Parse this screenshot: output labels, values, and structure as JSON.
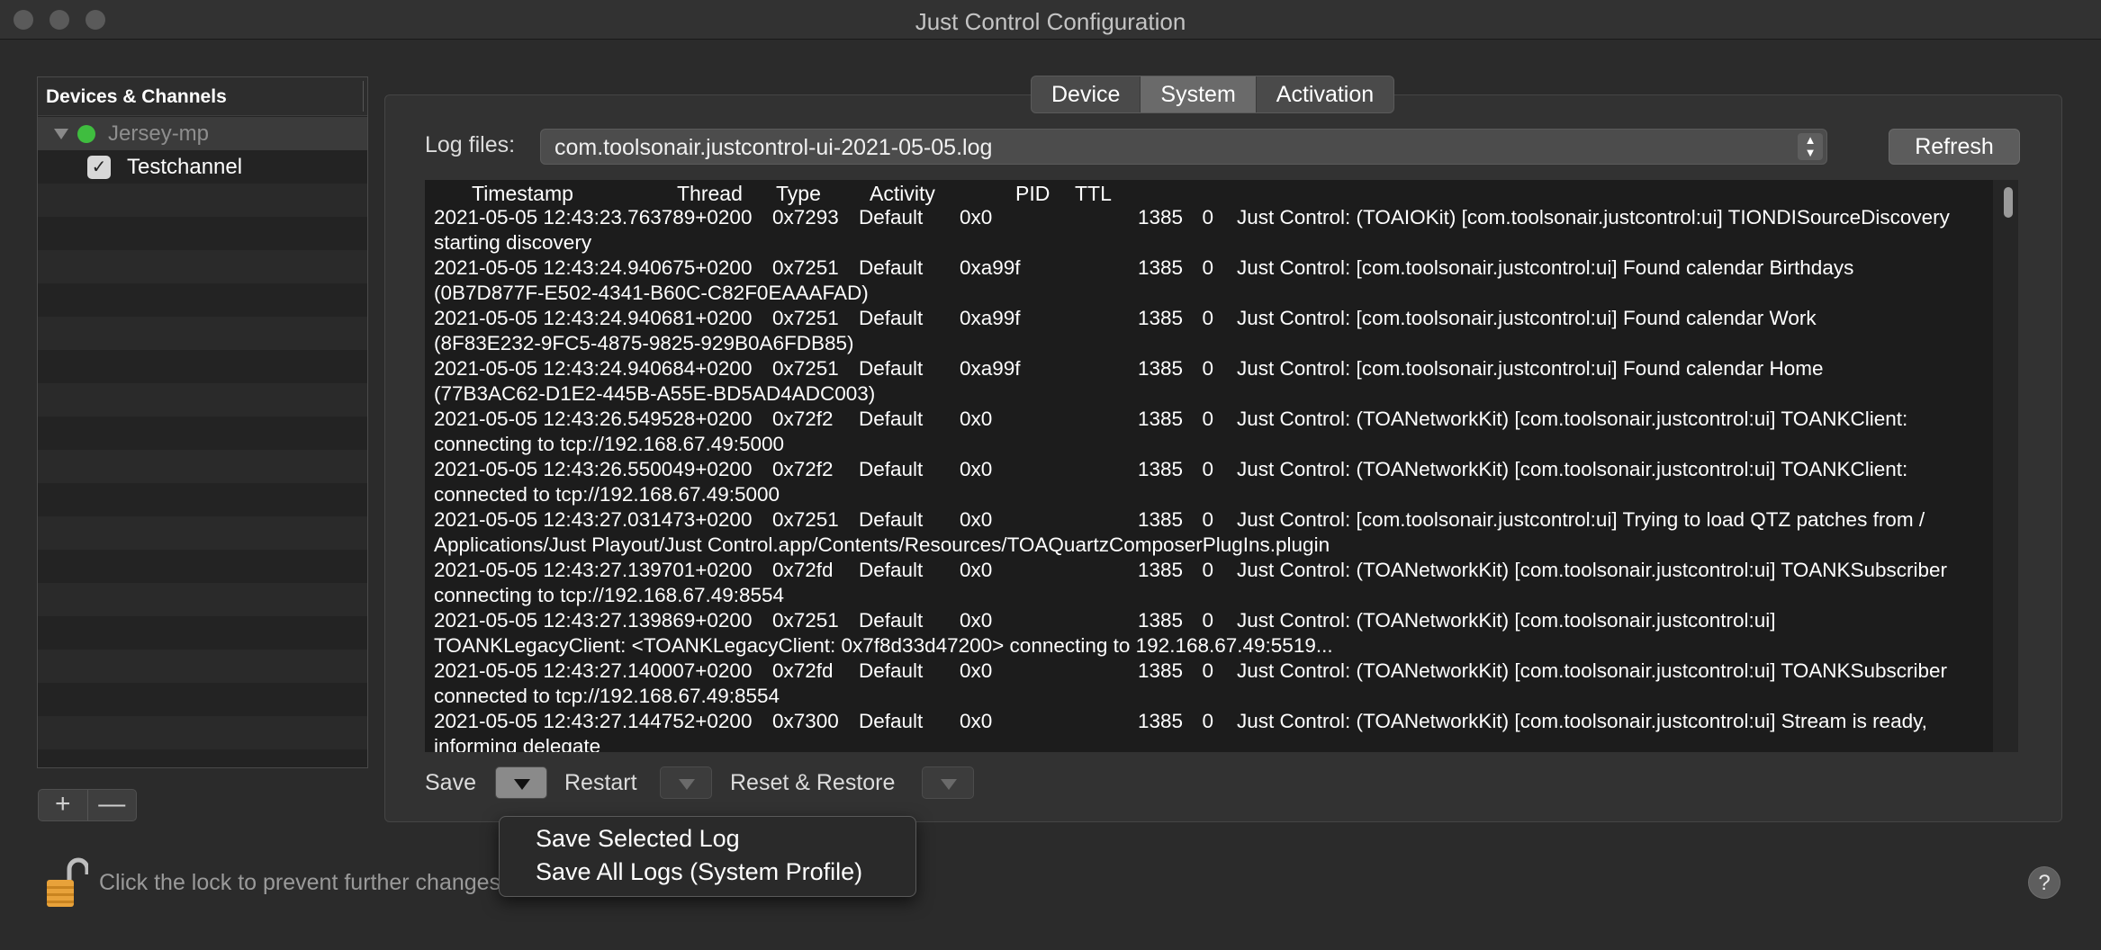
{
  "window": {
    "title": "Just Control Configuration"
  },
  "sidebar": {
    "header": "Devices & Channels",
    "device": {
      "label": "Jersey-mp",
      "status_color": "#3fbd3f"
    },
    "channel": {
      "label": "Testchannel",
      "checked": true
    },
    "buttons": {
      "add": "+",
      "remove": "—"
    }
  },
  "tabs": [
    {
      "label": "Device",
      "active": false
    },
    {
      "label": "System",
      "active": true
    },
    {
      "label": "Activation",
      "active": false
    }
  ],
  "logfiles": {
    "label": "Log files:",
    "selected": "com.toolsonair.justcontrol-ui-2021-05-05.log",
    "refresh": "Refresh"
  },
  "log": {
    "columns": [
      "Timestamp",
      "Thread",
      "Type",
      "Activity",
      "PID",
      "TTL"
    ],
    "entries": [
      {
        "ts": "2021-05-05 12:43:23.763789+0200",
        "thread": "0x7293",
        "type": "Default",
        "activity": "0x0",
        "pid": "1385",
        "ttl": "0",
        "msg": "Just Control: (TOAIOKit) [com.toolsonair.justcontrol:ui] TIONDISourceDiscovery",
        "cont": "starting discovery"
      },
      {
        "ts": "2021-05-05 12:43:24.940675+0200",
        "thread": "0x7251",
        "type": "Default",
        "activity": "0xa99f",
        "pid": "1385",
        "ttl": "0",
        "msg": "Just Control: [com.toolsonair.justcontrol:ui] Found calendar Birthdays",
        "cont": "(0B7D877F-E502-4341-B60C-C82F0EAAAFAD)"
      },
      {
        "ts": "2021-05-05 12:43:24.940681+0200",
        "thread": "0x7251",
        "type": "Default",
        "activity": "0xa99f",
        "pid": "1385",
        "ttl": "0",
        "msg": "Just Control: [com.toolsonair.justcontrol:ui] Found calendar Work",
        "cont": "(8F83E232-9FC5-4875-9825-929B0A6FDB85)"
      },
      {
        "ts": "2021-05-05 12:43:24.940684+0200",
        "thread": "0x7251",
        "type": "Default",
        "activity": "0xa99f",
        "pid": "1385",
        "ttl": "0",
        "msg": "Just Control: [com.toolsonair.justcontrol:ui] Found calendar Home",
        "cont": "(77B3AC62-D1E2-445B-A55E-BD5AD4ADC003)"
      },
      {
        "ts": "2021-05-05 12:43:26.549528+0200",
        "thread": "0x72f2",
        "type": "Default",
        "activity": "0x0",
        "pid": "1385",
        "ttl": "0",
        "msg": "Just Control: (TOANetworkKit) [com.toolsonair.justcontrol:ui] TOANKClient:",
        "cont": "connecting to tcp://192.168.67.49:5000"
      },
      {
        "ts": "2021-05-05 12:43:26.550049+0200",
        "thread": "0x72f2",
        "type": "Default",
        "activity": "0x0",
        "pid": "1385",
        "ttl": "0",
        "msg": "Just Control: (TOANetworkKit) [com.toolsonair.justcontrol:ui] TOANKClient:",
        "cont": "connected to tcp://192.168.67.49:5000"
      },
      {
        "ts": "2021-05-05 12:43:27.031473+0200",
        "thread": "0x7251",
        "type": "Default",
        "activity": "0x0",
        "pid": "1385",
        "ttl": "0",
        "msg": "Just Control: [com.toolsonair.justcontrol:ui] Trying to load QTZ patches from /",
        "cont": "Applications/Just Playout/Just Control.app/Contents/Resources/TOAQuartzComposerPlugIns.plugin"
      },
      {
        "ts": "2021-05-05 12:43:27.139701+0200",
        "thread": "0x72fd",
        "type": "Default",
        "activity": "0x0",
        "pid": "1385",
        "ttl": "0",
        "msg": "Just Control: (TOANetworkKit) [com.toolsonair.justcontrol:ui] TOANKSubscriber",
        "cont": "connecting to tcp://192.168.67.49:8554"
      },
      {
        "ts": "2021-05-05 12:43:27.139869+0200",
        "thread": "0x7251",
        "type": "Default",
        "activity": "0x0",
        "pid": "1385",
        "ttl": "0",
        "msg": "Just Control: (TOANetworkKit) [com.toolsonair.justcontrol:ui]",
        "cont": "TOANKLegacyClient: <TOANKLegacyClient: 0x7f8d33d47200> connecting to 192.168.67.49:5519..."
      },
      {
        "ts": "2021-05-05 12:43:27.140007+0200",
        "thread": "0x72fd",
        "type": "Default",
        "activity": "0x0",
        "pid": "1385",
        "ttl": "0",
        "msg": "Just Control: (TOANetworkKit) [com.toolsonair.justcontrol:ui] TOANKSubscriber",
        "cont": "connected to tcp://192.168.67.49:8554"
      },
      {
        "ts": "2021-05-05 12:43:27.144752+0200",
        "thread": "0x7300",
        "type": "Default",
        "activity": "0x0",
        "pid": "1385",
        "ttl": "0",
        "msg": "Just Control: (TOANetworkKit) [com.toolsonair.justcontrol:ui] Stream is ready,",
        "cont": "informing delegate"
      }
    ]
  },
  "controls": {
    "save": "Save",
    "restart": "Restart",
    "reset": "Reset & Restore"
  },
  "menu": {
    "items": [
      "Save Selected Log",
      "Save All Logs (System Profile)"
    ]
  },
  "footer": {
    "lock_text": "Click the lock to prevent further changes.",
    "help": "?"
  }
}
